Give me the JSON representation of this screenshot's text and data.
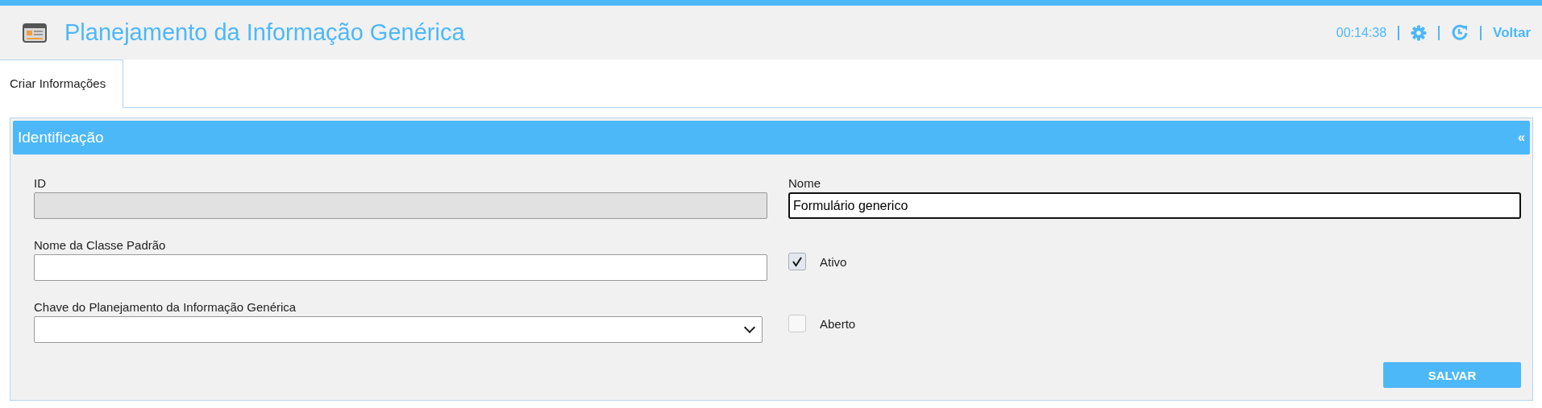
{
  "header": {
    "title": "Planejamento da Informação Genérica",
    "timer": "00:14:38",
    "back_link": "Voltar"
  },
  "tabs": [
    {
      "label": "Criar Informações",
      "selected": true
    }
  ],
  "panel": {
    "title": "Identificação",
    "collapse": "«"
  },
  "left_fields": [
    {
      "kind": "text",
      "label": "ID",
      "disabled": true
    },
    {
      "kind": "text",
      "label": "Nome da Classe Padrão",
      "disabled": false
    },
    {
      "kind": "select",
      "label": "Chave do Planejamento da Informação Genérica",
      "disabled": false
    }
  ],
  "right_fields": [
    {
      "kind": "text",
      "label": "Nome",
      "value": "Formulário generico",
      "focused": true
    },
    {
      "kind": "checkbox",
      "label": "Ativo",
      "checked": true
    },
    {
      "kind": "checkbox",
      "label": "Aberto",
      "checked": false
    }
  ],
  "buttons": [
    "SALVAR"
  ]
}
